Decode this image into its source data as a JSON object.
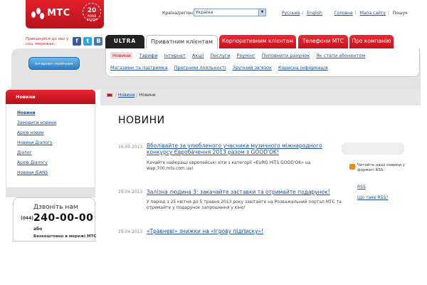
{
  "logo": {
    "brand": "МТС",
    "anniversary_number": "20",
    "anniversary_text": "РОКІВ РАЗОМ"
  },
  "topbar": {
    "country_label": "Країна/регіон:",
    "country_value": "Україна",
    "links": [
      "Русский",
      "English",
      "Головна",
      "Мапа сайту"
    ],
    "search": "Пошук"
  },
  "social": {
    "text": "Приєднуйся до нас у соц. мережах:",
    "icons": [
      "f",
      "t",
      "B"
    ]
  },
  "tabs": [
    "ULTRA",
    "Приватним клієнтам",
    "Корпоративним клієнтам",
    "Телефони МТС",
    "Про компанію"
  ],
  "subnav": {
    "row1": [
      "Новини",
      "Тарифи",
      "Інтернет",
      "Акції",
      "Послуги",
      "Роумінг",
      "Поповнити рахунок",
      "Як стати абонентом"
    ],
    "row2": [
      "Магазини та підтримка",
      "Програми лояльності",
      "Зручний зв'язок",
      "Корисна інформація"
    ]
  },
  "helper_button": "Інтернет-помічник",
  "sidebar": {
    "title": "Новини",
    "items": [
      "Новини",
      "Замовити новини",
      "Архів новин",
      "Новини Діалогу",
      "Діалог",
      "Архів Діалогу",
      "Новини JEANS"
    ]
  },
  "phone": {
    "call": "Дзвоніть нам",
    "code": "(044)",
    "number": "240-00-00",
    "or": "або",
    "free": "Безкоштовно в мережі МТС"
  },
  "breadcrumb": [
    "Новини",
    "Новини"
  ],
  "page_title": "НОВИНИ",
  "news": [
    {
      "date": "16.05.2013",
      "title": "Вболівайте за улюбленого учасника музичного міжнародного конкурсу Євробачення 2013 разом з GOOD'OK!",
      "text": "Качайте найкращі європейські хіти з категорії «EURO HITS GOOD'OK» на wap.700.mts.com.ua!"
    },
    {
      "date": "29.04.2013",
      "title": "Залізна людина 3: закачайте заставки та отримайте подарунок!",
      "text": "У період з 25 квітня до 5 травня 2013 року завітайте на Розважальний портал МТС та отримайте у подарунок запрошення у кіно!"
    },
    {
      "date": "29.04.2013",
      "title": "«Травневі» знижки на «Ігрову підписку»!",
      "text": ""
    }
  ],
  "rss": {
    "text": "Читайте наші новини у форматі RSS:",
    "link": "RSS",
    "what": "Що таке RSS?"
  },
  "colors": {
    "brand_red": "#e2202c",
    "link_blue": "#1a4f9c",
    "rss_orange": "#f28c1f"
  }
}
